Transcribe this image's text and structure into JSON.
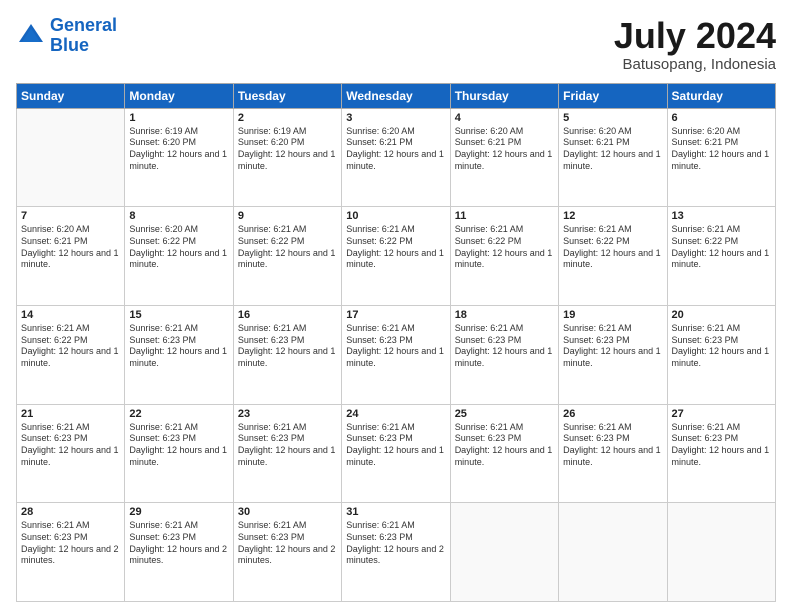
{
  "logo": {
    "line1": "General",
    "line2": "Blue"
  },
  "title": "July 2024",
  "subtitle": "Batusopang, Indonesia",
  "days_of_week": [
    "Sunday",
    "Monday",
    "Tuesday",
    "Wednesday",
    "Thursday",
    "Friday",
    "Saturday"
  ],
  "weeks": [
    [
      {
        "day": "",
        "info": ""
      },
      {
        "day": "1",
        "info": "Sunrise: 6:19 AM\nSunset: 6:20 PM\nDaylight: 12 hours and 1 minute."
      },
      {
        "day": "2",
        "info": "Sunrise: 6:19 AM\nSunset: 6:20 PM\nDaylight: 12 hours and 1 minute."
      },
      {
        "day": "3",
        "info": "Sunrise: 6:20 AM\nSunset: 6:21 PM\nDaylight: 12 hours and 1 minute."
      },
      {
        "day": "4",
        "info": "Sunrise: 6:20 AM\nSunset: 6:21 PM\nDaylight: 12 hours and 1 minute."
      },
      {
        "day": "5",
        "info": "Sunrise: 6:20 AM\nSunset: 6:21 PM\nDaylight: 12 hours and 1 minute."
      },
      {
        "day": "6",
        "info": "Sunrise: 6:20 AM\nSunset: 6:21 PM\nDaylight: 12 hours and 1 minute."
      }
    ],
    [
      {
        "day": "7",
        "info": "Sunrise: 6:20 AM\nSunset: 6:21 PM\nDaylight: 12 hours and 1 minute."
      },
      {
        "day": "8",
        "info": "Sunrise: 6:20 AM\nSunset: 6:22 PM\nDaylight: 12 hours and 1 minute."
      },
      {
        "day": "9",
        "info": "Sunrise: 6:21 AM\nSunset: 6:22 PM\nDaylight: 12 hours and 1 minute."
      },
      {
        "day": "10",
        "info": "Sunrise: 6:21 AM\nSunset: 6:22 PM\nDaylight: 12 hours and 1 minute."
      },
      {
        "day": "11",
        "info": "Sunrise: 6:21 AM\nSunset: 6:22 PM\nDaylight: 12 hours and 1 minute."
      },
      {
        "day": "12",
        "info": "Sunrise: 6:21 AM\nSunset: 6:22 PM\nDaylight: 12 hours and 1 minute."
      },
      {
        "day": "13",
        "info": "Sunrise: 6:21 AM\nSunset: 6:22 PM\nDaylight: 12 hours and 1 minute."
      }
    ],
    [
      {
        "day": "14",
        "info": "Sunrise: 6:21 AM\nSunset: 6:22 PM\nDaylight: 12 hours and 1 minute."
      },
      {
        "day": "15",
        "info": "Sunrise: 6:21 AM\nSunset: 6:23 PM\nDaylight: 12 hours and 1 minute."
      },
      {
        "day": "16",
        "info": "Sunrise: 6:21 AM\nSunset: 6:23 PM\nDaylight: 12 hours and 1 minute."
      },
      {
        "day": "17",
        "info": "Sunrise: 6:21 AM\nSunset: 6:23 PM\nDaylight: 12 hours and 1 minute."
      },
      {
        "day": "18",
        "info": "Sunrise: 6:21 AM\nSunset: 6:23 PM\nDaylight: 12 hours and 1 minute."
      },
      {
        "day": "19",
        "info": "Sunrise: 6:21 AM\nSunset: 6:23 PM\nDaylight: 12 hours and 1 minute."
      },
      {
        "day": "20",
        "info": "Sunrise: 6:21 AM\nSunset: 6:23 PM\nDaylight: 12 hours and 1 minute."
      }
    ],
    [
      {
        "day": "21",
        "info": "Sunrise: 6:21 AM\nSunset: 6:23 PM\nDaylight: 12 hours and 1 minute."
      },
      {
        "day": "22",
        "info": "Sunrise: 6:21 AM\nSunset: 6:23 PM\nDaylight: 12 hours and 1 minute."
      },
      {
        "day": "23",
        "info": "Sunrise: 6:21 AM\nSunset: 6:23 PM\nDaylight: 12 hours and 1 minute."
      },
      {
        "day": "24",
        "info": "Sunrise: 6:21 AM\nSunset: 6:23 PM\nDaylight: 12 hours and 1 minute."
      },
      {
        "day": "25",
        "info": "Sunrise: 6:21 AM\nSunset: 6:23 PM\nDaylight: 12 hours and 1 minute."
      },
      {
        "day": "26",
        "info": "Sunrise: 6:21 AM\nSunset: 6:23 PM\nDaylight: 12 hours and 1 minute."
      },
      {
        "day": "27",
        "info": "Sunrise: 6:21 AM\nSunset: 6:23 PM\nDaylight: 12 hours and 1 minute."
      }
    ],
    [
      {
        "day": "28",
        "info": "Sunrise: 6:21 AM\nSunset: 6:23 PM\nDaylight: 12 hours and 2 minutes."
      },
      {
        "day": "29",
        "info": "Sunrise: 6:21 AM\nSunset: 6:23 PM\nDaylight: 12 hours and 2 minutes."
      },
      {
        "day": "30",
        "info": "Sunrise: 6:21 AM\nSunset: 6:23 PM\nDaylight: 12 hours and 2 minutes."
      },
      {
        "day": "31",
        "info": "Sunrise: 6:21 AM\nSunset: 6:23 PM\nDaylight: 12 hours and 2 minutes."
      },
      {
        "day": "",
        "info": ""
      },
      {
        "day": "",
        "info": ""
      },
      {
        "day": "",
        "info": ""
      }
    ]
  ]
}
